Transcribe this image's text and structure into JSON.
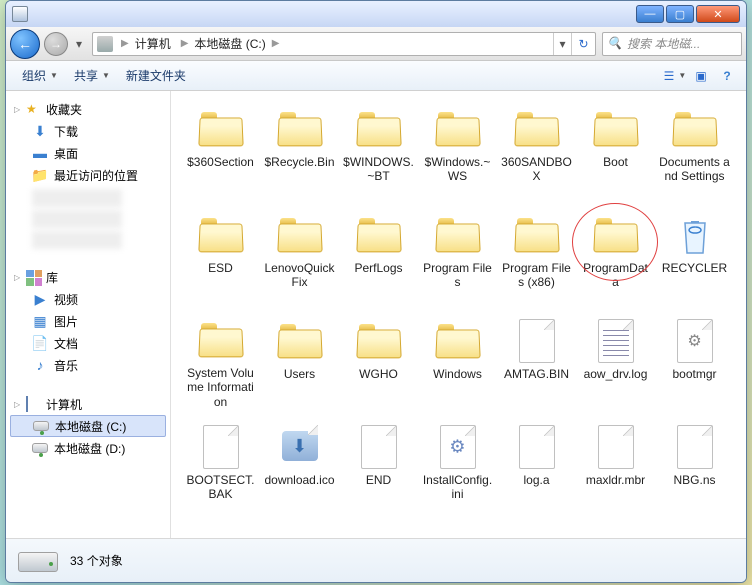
{
  "title": "",
  "window_controls": {
    "min": "—",
    "max": "▢",
    "close": "✕"
  },
  "nav": {
    "back": "←",
    "forward": "→",
    "drop": "▾",
    "refresh": "↻"
  },
  "breadcrumb": [
    {
      "label": "计算机"
    },
    {
      "label": "本地磁盘 (C:)"
    }
  ],
  "search_placeholder": "搜索 本地磁...",
  "toolbar": {
    "organize": "组织",
    "share": "共享",
    "new_folder": "新建文件夹"
  },
  "sidebar": {
    "favorites": {
      "label": "收藏夹"
    },
    "fav_items": [
      {
        "label": "下载",
        "icon": "⬇",
        "color": "#3a80d0"
      },
      {
        "label": "桌面",
        "icon": "▬",
        "color": "#3a80d0"
      },
      {
        "label": "最近访问的位置",
        "icon": "📁",
        "color": "#d4a830"
      }
    ],
    "libraries": {
      "label": "库"
    },
    "lib_items": [
      {
        "label": "视频",
        "icon": "▶",
        "color": "#3a80d0"
      },
      {
        "label": "图片",
        "icon": "▦",
        "color": "#3a80d0"
      },
      {
        "label": "文档",
        "icon": "📄",
        "color": "#3a80d0"
      },
      {
        "label": "音乐",
        "icon": "♪",
        "color": "#3a80d0"
      }
    ],
    "computer": {
      "label": "计算机"
    },
    "drives": [
      {
        "label": "本地磁盘 (C:)",
        "selected": true
      },
      {
        "label": "本地磁盘 (D:)",
        "selected": false
      }
    ]
  },
  "items": [
    {
      "name": "$360Section",
      "type": "folder"
    },
    {
      "name": "$Recycle.Bin",
      "type": "folder"
    },
    {
      "name": "$WINDOWS.~BT",
      "type": "folder"
    },
    {
      "name": "$Windows.~WS",
      "type": "folder"
    },
    {
      "name": "360SANDBOX",
      "type": "folder"
    },
    {
      "name": "Boot",
      "type": "folder"
    },
    {
      "name": "Documents and Settings",
      "type": "folder"
    },
    {
      "name": "ESD",
      "type": "folder"
    },
    {
      "name": "LenovoQuickFix",
      "type": "folder"
    },
    {
      "name": "PerfLogs",
      "type": "folder"
    },
    {
      "name": "Program Files",
      "type": "folder"
    },
    {
      "name": "Program Files (x86)",
      "type": "folder"
    },
    {
      "name": "ProgramData",
      "type": "folder",
      "circled": true
    },
    {
      "name": "RECYCLER",
      "type": "recycle"
    },
    {
      "name": "System Volume Information",
      "type": "folder"
    },
    {
      "name": "Users",
      "type": "folder"
    },
    {
      "name": "WGHO",
      "type": "folder"
    },
    {
      "name": "Windows",
      "type": "folder"
    },
    {
      "name": "AMTAG.BIN",
      "type": "file"
    },
    {
      "name": "aow_drv.log",
      "type": "file-text"
    },
    {
      "name": "bootmgr",
      "type": "file-sys"
    },
    {
      "name": "BOOTSECT.BAK",
      "type": "file"
    },
    {
      "name": "download.ico",
      "type": "file-dl"
    },
    {
      "name": "END",
      "type": "file"
    },
    {
      "name": "InstallConfig.ini",
      "type": "file-ini"
    },
    {
      "name": "log.a",
      "type": "file"
    },
    {
      "name": "maxldr.mbr",
      "type": "file"
    },
    {
      "name": "NBG.ns",
      "type": "file"
    }
  ],
  "status": {
    "count": "33",
    "objects_label": "个对象"
  }
}
